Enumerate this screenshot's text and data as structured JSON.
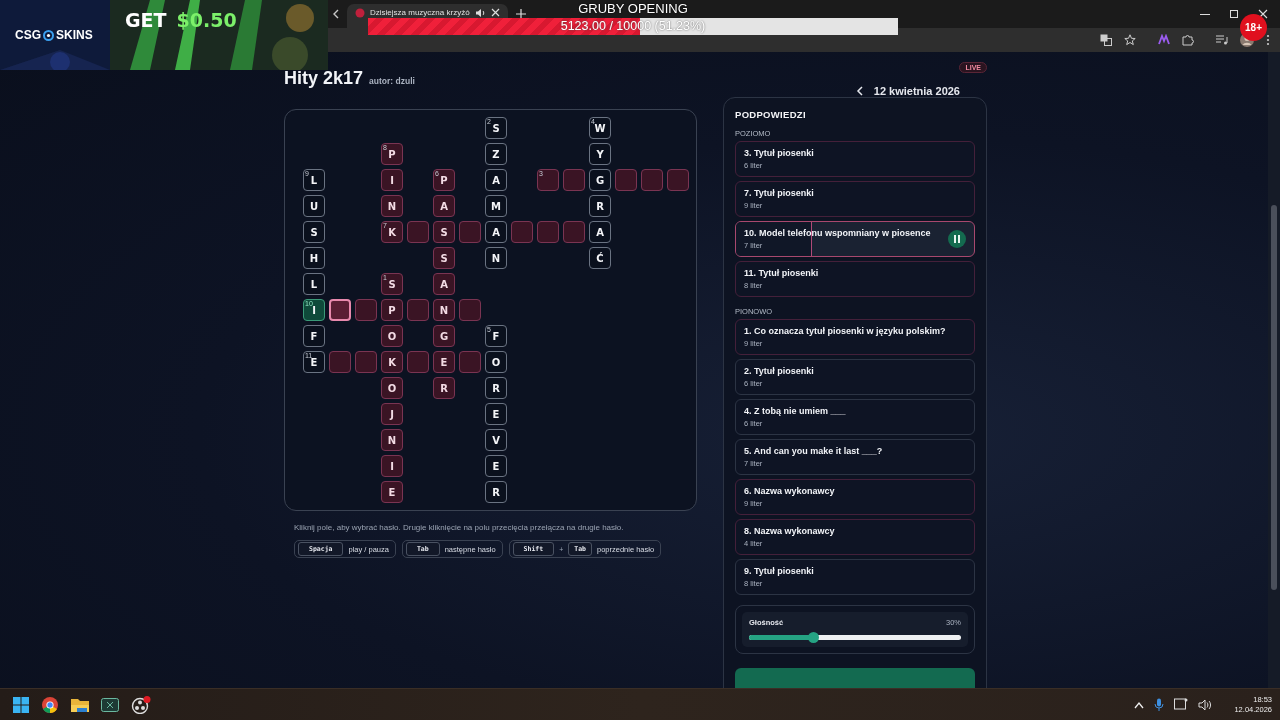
{
  "browser": {
    "tab_title": "Dzisiejsza muzyczna krzyżó"
  },
  "overlay": {
    "ad": {
      "brand_left": "CSG",
      "brand_right": "SKINS",
      "offer_label": "GET",
      "offer_value": "$0.50"
    },
    "goal": {
      "title": "GRUBY OPENING",
      "level": 0.5123,
      "reading": "5123.00 / 10000 (51.23%)"
    },
    "age_badge": "18+"
  },
  "page": {
    "title": "Hity 2k17",
    "author": "autor: dzuli",
    "live": "LIVE",
    "date": "12 kwietnia 2026"
  },
  "crossword": {
    "rows": [
      [
        null,
        null,
        null,
        null,
        null,
        null,
        null,
        {
          "kind": "solved",
          "letter": "S",
          "number": "2"
        },
        null,
        null,
        null,
        {
          "kind": "solved",
          "letter": "W",
          "number": "4"
        },
        null,
        null,
        null
      ],
      [
        null,
        null,
        null,
        {
          "kind": "open",
          "letter": "P",
          "number": "8"
        },
        null,
        null,
        null,
        {
          "kind": "solved",
          "letter": "Z"
        },
        null,
        null,
        null,
        {
          "kind": "solved",
          "letter": "Y"
        },
        null,
        null,
        null
      ],
      [
        {
          "kind": "solved",
          "letter": "L",
          "number": "9"
        },
        null,
        null,
        {
          "kind": "open",
          "letter": "I"
        },
        null,
        {
          "kind": "open",
          "letter": "P",
          "number": "6"
        },
        null,
        {
          "kind": "solved",
          "letter": "A"
        },
        null,
        {
          "kind": "open",
          "number": "3"
        },
        {
          "kind": "open"
        },
        {
          "kind": "solved",
          "letter": "G"
        },
        {
          "kind": "open"
        },
        {
          "kind": "open"
        },
        {
          "kind": "open"
        }
      ],
      [
        {
          "kind": "solved",
          "letter": "U"
        },
        null,
        null,
        {
          "kind": "open",
          "letter": "N"
        },
        null,
        {
          "kind": "open",
          "letter": "A"
        },
        null,
        {
          "kind": "solved",
          "letter": "M"
        },
        null,
        null,
        null,
        {
          "kind": "solved",
          "letter": "R"
        },
        null,
        null,
        null
      ],
      [
        {
          "kind": "solved",
          "letter": "S"
        },
        null,
        null,
        {
          "kind": "open",
          "letter": "K",
          "number": "7"
        },
        {
          "kind": "open"
        },
        {
          "kind": "open",
          "letter": "S"
        },
        {
          "kind": "open"
        },
        {
          "kind": "solved",
          "letter": "A"
        },
        {
          "kind": "open"
        },
        {
          "kind": "open"
        },
        {
          "kind": "open"
        },
        {
          "kind": "solved",
          "letter": "A"
        },
        null,
        null,
        null
      ],
      [
        {
          "kind": "solved",
          "letter": "H"
        },
        null,
        null,
        null,
        null,
        {
          "kind": "open",
          "letter": "S"
        },
        null,
        {
          "kind": "solved",
          "letter": "N"
        },
        null,
        null,
        null,
        {
          "kind": "solved",
          "letter": "Ć"
        },
        null,
        null,
        null
      ],
      [
        {
          "kind": "solved",
          "letter": "L"
        },
        null,
        null,
        {
          "kind": "open",
          "letter": "S",
          "number": "1"
        },
        null,
        {
          "kind": "open",
          "letter": "A"
        },
        null,
        null,
        null,
        null,
        null,
        null,
        null,
        null,
        null
      ],
      [
        {
          "kind": "active",
          "letter": "I",
          "number": "10"
        },
        {
          "kind": "cursor"
        },
        {
          "kind": "open"
        },
        {
          "kind": "open",
          "letter": "P"
        },
        {
          "kind": "open"
        },
        {
          "kind": "open",
          "letter": "N"
        },
        {
          "kind": "open"
        },
        null,
        null,
        null,
        null,
        null,
        null,
        null,
        null
      ],
      [
        {
          "kind": "solved",
          "letter": "F"
        },
        null,
        null,
        {
          "kind": "open",
          "letter": "O"
        },
        null,
        {
          "kind": "open",
          "letter": "G"
        },
        null,
        {
          "kind": "solved",
          "letter": "F",
          "number": "5"
        },
        null,
        null,
        null,
        null,
        null,
        null,
        null
      ],
      [
        {
          "kind": "solved",
          "letter": "E",
          "number": "11"
        },
        {
          "kind": "open"
        },
        {
          "kind": "open"
        },
        {
          "kind": "open",
          "letter": "K"
        },
        {
          "kind": "open"
        },
        {
          "kind": "open",
          "letter": "E"
        },
        {
          "kind": "open"
        },
        {
          "kind": "solved",
          "letter": "O"
        },
        null,
        null,
        null,
        null,
        null,
        null,
        null
      ],
      [
        null,
        null,
        null,
        {
          "kind": "open",
          "letter": "O"
        },
        null,
        {
          "kind": "open",
          "letter": "R"
        },
        null,
        {
          "kind": "solved",
          "letter": "R"
        },
        null,
        null,
        null,
        null,
        null,
        null,
        null
      ],
      [
        null,
        null,
        null,
        {
          "kind": "open",
          "letter": "J"
        },
        null,
        null,
        null,
        {
          "kind": "solved",
          "letter": "E"
        },
        null,
        null,
        null,
        null,
        null,
        null,
        null
      ],
      [
        null,
        null,
        null,
        {
          "kind": "open",
          "letter": "N"
        },
        null,
        null,
        null,
        {
          "kind": "solved",
          "letter": "V"
        },
        null,
        null,
        null,
        null,
        null,
        null,
        null
      ],
      [
        null,
        null,
        null,
        {
          "kind": "open",
          "letter": "I"
        },
        null,
        null,
        null,
        {
          "kind": "solved",
          "letter": "E"
        },
        null,
        null,
        null,
        null,
        null,
        null,
        null
      ],
      [
        null,
        null,
        null,
        {
          "kind": "open",
          "letter": "E"
        },
        null,
        null,
        null,
        {
          "kind": "solved",
          "letter": "R"
        },
        null,
        null,
        null,
        null,
        null,
        null,
        null
      ]
    ]
  },
  "hint": "Kliknij pole, aby wybrać hasło. Drugie kliknięcie na polu przecięcia przełącza na drugie hasło.",
  "shortcuts": [
    {
      "keys": [
        "Spacja"
      ],
      "label": "play / pauza"
    },
    {
      "keys": [
        "Tab"
      ],
      "label": "następne hasło"
    },
    {
      "keys": [
        "Shift",
        "Tab"
      ],
      "separator": "+",
      "label": "poprzednie hasło"
    }
  ],
  "clues": {
    "title": "PODPOWIEDZI",
    "groups": [
      {
        "heading": "POZIOMO",
        "items": [
          {
            "text": "3. Tytuł piosenki",
            "length": "6 liter",
            "solved": false,
            "selected": false
          },
          {
            "text": "7. Tytuł piosenki",
            "length": "9 liter",
            "solved": false,
            "selected": false
          },
          {
            "text": "10. Model telefonu wspomniany w piosence",
            "length": "7 liter",
            "solved": false,
            "selected": true,
            "playing": true,
            "level": 0.32
          },
          {
            "text": "11. Tytuł piosenki",
            "length": "8 liter",
            "solved": false,
            "selected": false
          }
        ]
      },
      {
        "heading": "PIONOWO",
        "items": [
          {
            "text": "1. Co oznacza tytuł piosenki w języku polskim?",
            "length": "9 liter",
            "solved": false,
            "selected": false
          },
          {
            "text": "2. Tytuł piosenki",
            "length": "6 liter",
            "solved": true,
            "selected": false
          },
          {
            "text": "4. Z tobą nie umiem ___",
            "length": "6 liter",
            "solved": true,
            "selected": false
          },
          {
            "text": "5. And can you make it last ___?",
            "length": "7 liter",
            "solved": true,
            "selected": false
          },
          {
            "text": "6. Nazwa wykonawcy",
            "length": "9 liter",
            "solved": false,
            "selected": false
          },
          {
            "text": "8. Nazwa wykonawcy",
            "length": "4 liter",
            "solved": false,
            "selected": false
          },
          {
            "text": "9. Tytuł piosenki",
            "length": "8 liter",
            "solved": true,
            "selected": false
          }
        ]
      }
    ]
  },
  "volume": {
    "label": "Głośność",
    "reading": "30%",
    "level": 0.3
  },
  "taskbar": {
    "time": "18:53",
    "date": "12.04.2026"
  }
}
